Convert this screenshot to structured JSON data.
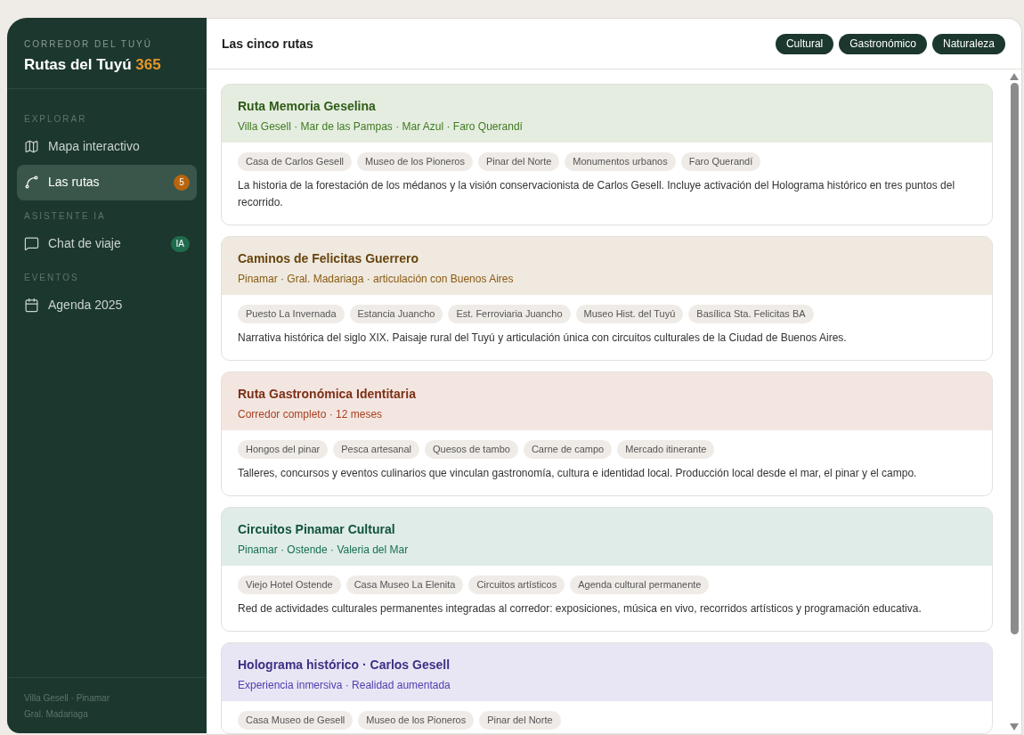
{
  "sidebar": {
    "eyebrow": "CORREDOR DEL TUYÚ",
    "brand": "Rutas del Tuyú",
    "brand_accent": "365",
    "sections": [
      {
        "title": "EXPLORAR",
        "items": [
          {
            "label": "Mapa interactivo",
            "selected": false
          },
          {
            "label": "Las rutas",
            "selected": true,
            "badge": {
              "text": "5",
              "color": "#b8650f"
            }
          }
        ]
      },
      {
        "title": "ASISTENTE IA",
        "items": [
          {
            "label": "Chat de viaje",
            "selected": false,
            "badge": {
              "text": "IA",
              "color": "#1f6b4e"
            }
          }
        ]
      },
      {
        "title": "EVENTOS",
        "items": [
          {
            "label": "Agenda 2025",
            "selected": false
          }
        ]
      }
    ],
    "footer": [
      "Villa Gesell · Pinamar",
      "Gral. Madariaga"
    ]
  },
  "header": {
    "title": "Las cinco rutas",
    "filters": [
      "Cultural",
      "Gastronómico",
      "Naturaleza"
    ]
  },
  "routes": [
    {
      "title": "Ruta Memoria Geselina",
      "subtitle": "Villa Gesell · Mar de las Pampas · Mar Azul · Faro Querandí",
      "color": "#3f7a1f",
      "tags": [
        "Casa de Carlos Gesell",
        "Museo de los Pioneros",
        "Pinar del Norte",
        "Monumentos urbanos",
        "Faro Querandí"
      ],
      "description": "La historia de la forestación de los médanos y la visión conservacionista de Carlos Gesell. Incluye activación del Holograma histórico en tres puntos del recorrido."
    },
    {
      "title": "Caminos de Felicitas Guerrero",
      "subtitle": "Pinamar · Gral. Madariaga · articulación con Buenos Aires",
      "color": "#8a5a12",
      "tags": [
        "Puesto La Invernada",
        "Estancia Juancho",
        "Est. Ferroviaria Juancho",
        "Museo Hist. del Tuyú",
        "Basílica Sta. Felicitas BA"
      ],
      "description": "Narrativa histórica del siglo XIX. Paisaje rural del Tuyú y articulación única con circuitos culturales de la Ciudad de Buenos Aires."
    },
    {
      "title": "Ruta Gastronómica Identitaria",
      "subtitle": "Corredor completo · 12 meses",
      "color": "#a8401f",
      "tags": [
        "Hongos del pinar",
        "Pesca artesanal",
        "Quesos de tambo",
        "Carne de campo",
        "Mercado itinerante"
      ],
      "description": "Talleres, concursos y eventos culinarios que vinculan gastronomía, cultura e identidad local. Producción local desde el mar, el pinar y el campo."
    },
    {
      "title": "Circuitos Pinamar Cultural",
      "subtitle": "Pinamar · Ostende · Valeria del Mar",
      "color": "#17704f",
      "tags": [
        "Viejo Hotel Ostende",
        "Casa Museo La Elenita",
        "Circuitos artísticos",
        "Agenda cultural permanente"
      ],
      "description": "Red de actividades culturales permanentes integradas al corredor: exposiciones, música en vivo, recorridos artísticos y programación educativa."
    },
    {
      "title": "Holograma histórico · Carlos Gesell",
      "subtitle": "Experiencia inmersiva · Realidad aumentada",
      "color": "#5040b0",
      "tags": [
        "Casa Museo de Gesell",
        "Museo de los Pioneros",
        "Pinar del Norte"
      ]
    }
  ]
}
